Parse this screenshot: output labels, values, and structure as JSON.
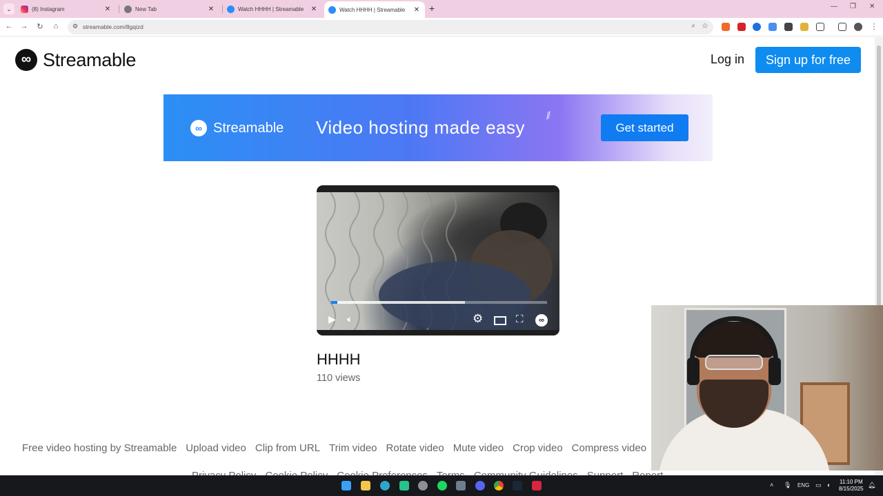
{
  "browser": {
    "tabs": [
      {
        "title": "(8) Instagram",
        "favicon": "instagram-icon",
        "color": "#e1306c"
      },
      {
        "title": "New Tab",
        "favicon": "chrome-icon",
        "color": "#555555"
      },
      {
        "title": "Watch HHHH | Streamable",
        "favicon": "streamable-icon",
        "color": "#2b8ff5"
      },
      {
        "title": "Watch HHHH | Streamable",
        "favicon": "streamable-icon",
        "color": "#2b8ff5"
      }
    ],
    "active_tab": 3,
    "url": "streamable.com/8gqizd"
  },
  "header": {
    "logo_text": "Streamable",
    "login_label": "Log in",
    "signup_label": "Sign up for free"
  },
  "banner": {
    "brand": "Streamable",
    "tagline": "Video hosting made easy",
    "cta_label": "Get started"
  },
  "video": {
    "title": "HHHH",
    "views": "110 views",
    "played_fraction": 0.03,
    "buffered_fraction": 0.62
  },
  "footer": {
    "links_row1": [
      "Free video hosting by Streamable",
      "Upload video",
      "Clip from URL",
      "Trim video",
      "Rotate video",
      "Mute video",
      "Crop video",
      "Compress video"
    ],
    "links_row2": [
      "Privacy Policy",
      "Cookie Policy",
      "Cookie Preferences",
      "Terms",
      "Community Guidelines",
      "Support",
      "Report"
    ]
  },
  "taskbar": {
    "language": "ENG",
    "time": "11:10 PM",
    "date": "8/15/2025"
  },
  "colors": {
    "brand_blue": "#0f8cf0",
    "tabstrip": "#f1cfe3",
    "taskbar": "#16181c"
  }
}
